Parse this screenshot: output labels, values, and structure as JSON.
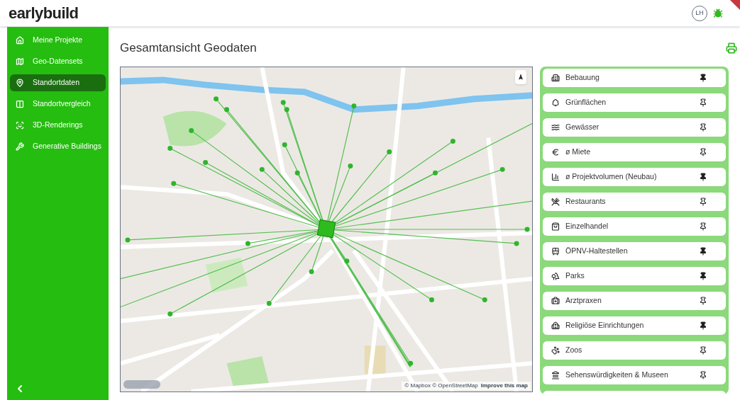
{
  "header": {
    "logo": "earlybuild",
    "user_initials": "LH"
  },
  "sidebar": {
    "items": [
      {
        "kind": "home",
        "label": "Meine Projekte",
        "selected": false
      },
      {
        "kind": "map",
        "label": "Geo-Datensets",
        "selected": false
      },
      {
        "kind": "pin",
        "label": "Standortdaten",
        "selected": true
      },
      {
        "kind": "compare",
        "label": "Standortvergleich",
        "selected": false
      },
      {
        "kind": "render",
        "label": "3D-Renderings",
        "selected": false
      },
      {
        "kind": "tools",
        "label": "Generative Buildings",
        "selected": false
      }
    ]
  },
  "page": {
    "title": "Gesamtansicht Geodaten"
  },
  "map": {
    "attribution": "© Mapbox © OpenStreetMap",
    "improve_link": "Improve this map"
  },
  "layers": [
    {
      "kind": "buildings",
      "label": "Bebauung",
      "pinned": true
    },
    {
      "kind": "green",
      "label": "Grünflächen",
      "pinned": false
    },
    {
      "kind": "water",
      "label": "Gewässer",
      "pinned": false
    },
    {
      "kind": "rent",
      "label": "ø Miete",
      "pinned": false
    },
    {
      "kind": "volume",
      "label": "ø Projektvolumen (Neubau)",
      "pinned": true
    },
    {
      "kind": "restaurants",
      "label": "Restaurants",
      "pinned": false
    },
    {
      "kind": "retail",
      "label": "Einzelhandel",
      "pinned": false
    },
    {
      "kind": "transit",
      "label": "ÖPNV-Haltestellen",
      "pinned": true
    },
    {
      "kind": "parks",
      "label": "Parks",
      "pinned": true
    },
    {
      "kind": "doctors",
      "label": "Arztpraxen",
      "pinned": false
    },
    {
      "kind": "religion",
      "label": "Religiöse Einrichtungen",
      "pinned": true
    },
    {
      "kind": "zoos",
      "label": "Zoos",
      "pinned": false
    },
    {
      "kind": "sights",
      "label": "Sehenswürdigkeiten & Museen",
      "pinned": false
    }
  ]
}
